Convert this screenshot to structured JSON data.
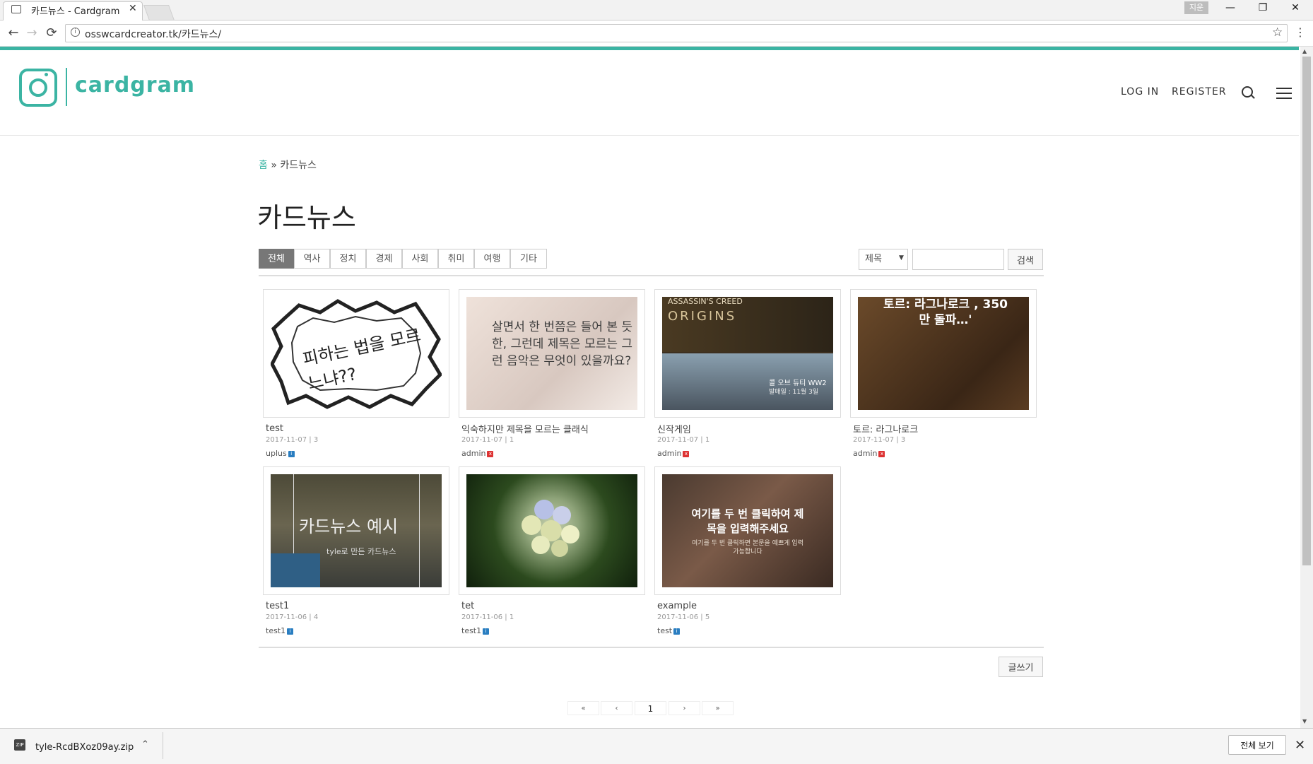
{
  "browser": {
    "tab_title": "카드뉴스 - Cardgram",
    "tab_close": "✕",
    "user_badge": "지운",
    "url": "osswcardcreator.tk/카드뉴스/",
    "minimize": "—",
    "restore": "❐",
    "close": "✕",
    "back": "←",
    "forward": "→",
    "reload": "⟳",
    "star": "☆",
    "menu": "⋮"
  },
  "site": {
    "logo_text": "cardgram",
    "nav": {
      "login": "LOG IN",
      "register": "REGISTER"
    },
    "accent": "#3bb4a3"
  },
  "breadcrumb": {
    "home": "홈",
    "sep": " » ",
    "current": "카드뉴스"
  },
  "page_title": "카드뉴스",
  "categories": [
    "전체",
    "역사",
    "정치",
    "경제",
    "사회",
    "취미",
    "여행",
    "기타"
  ],
  "search": {
    "select_value": "제목",
    "button": "검색",
    "input_value": ""
  },
  "cards": [
    {
      "title": "test",
      "meta": "2017-11-07 | 3",
      "author": "uplus",
      "badge": "i"
    },
    {
      "title": "익숙하지만 제목을 모르는 클래식",
      "meta": "2017-11-07 | 1",
      "author": "admin",
      "badge": "x"
    },
    {
      "title": "신작게임",
      "meta": "2017-11-07 | 1",
      "author": "admin",
      "badge": "x"
    },
    {
      "title": "토르: 라그나로크",
      "meta": "2017-11-07 | 3",
      "author": "admin",
      "badge": "x"
    },
    {
      "title": "test1",
      "meta": "2017-11-06 | 4",
      "author": "test1",
      "badge": "i"
    },
    {
      "title": "tet",
      "meta": "2017-11-06 | 1",
      "author": "test1",
      "badge": "i"
    },
    {
      "title": "example",
      "meta": "2017-11-06 | 5",
      "author": "test",
      "badge": "i"
    }
  ],
  "thumb_text": {
    "t1": "피하는 법을 모르느냐??",
    "t2": "살면서 한 번쯤은 들어 본 듯한, 그런데 제목은 모르는 그런 음악은 무엇이 있을까요?",
    "t3a": "ASSASSIN'S CREED",
    "t3b": "ORIGINS",
    "t3c": "콜 오브 듀티 WW2",
    "t3d": "발매일 : 11월 3일",
    "t4a": "토르: 라그나로크 , 350만 돌파…'",
    "t5a": "카드뉴스 예시",
    "t5b": "tyle로 만든 카드뉴스",
    "t7a": "여기를 두 번 클릭하여 제목을 입력해주세요",
    "t7b": "여기를 두 번 클릭하면 본문을 예쁘게 입력 가능합니다"
  },
  "write_button": "글쓰기",
  "pagination": [
    "«",
    "‹",
    "1",
    "›",
    "»"
  ],
  "download": {
    "filename": "tyle-RcdBXoz09ay.zip",
    "show_all": "전체 보기",
    "chevron": "⌃",
    "close": "✕"
  }
}
